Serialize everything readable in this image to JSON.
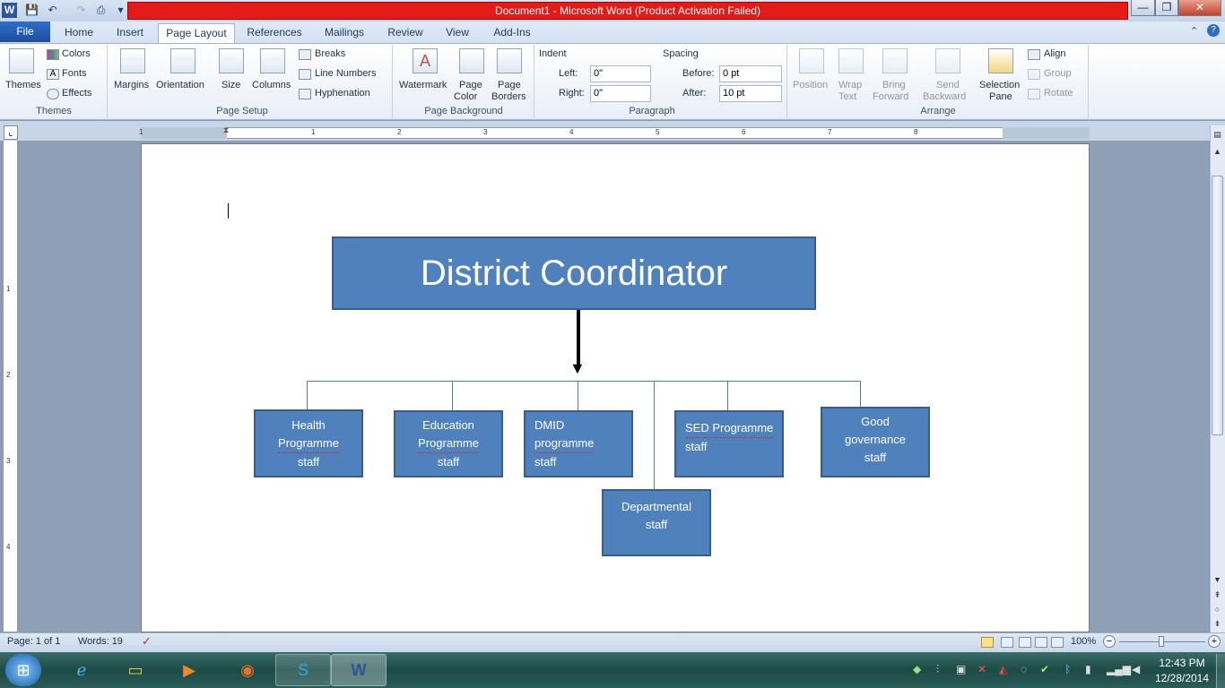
{
  "window": {
    "title": "Document1  -  Microsoft Word (Product Activation Failed)",
    "app_icon": "W"
  },
  "quick_access": {
    "save_icon": "💾",
    "undo_icon": "↶",
    "redo_icon": "↷",
    "print_icon": "⎙",
    "more_icon": "▾"
  },
  "window_controls": {
    "minimize": "—",
    "restore": "❐",
    "close": "✕"
  },
  "tabs": [
    {
      "label": "File"
    },
    {
      "label": "Home"
    },
    {
      "label": "Insert"
    },
    {
      "label": "Page Layout"
    },
    {
      "label": "References"
    },
    {
      "label": "Mailings"
    },
    {
      "label": "Review"
    },
    {
      "label": "View"
    },
    {
      "label": "Add-Ins"
    }
  ],
  "ribbon": {
    "themes": {
      "themes": "Themes",
      "colors": "Colors",
      "fonts": "Fonts",
      "effects": "Effects",
      "group": "Themes"
    },
    "page_setup": {
      "margins": "Margins",
      "orientation": "Orientation",
      "size": "Size",
      "columns": "Columns",
      "breaks": "Breaks",
      "line_numbers": "Line Numbers",
      "hyphenation": "Hyphenation",
      "group": "Page Setup"
    },
    "page_background": {
      "watermark": "Watermark",
      "page_color_1": "Page",
      "page_color_2": "Color",
      "page_borders_1": "Page",
      "page_borders_2": "Borders",
      "group": "Page Background"
    },
    "paragraph": {
      "indent": "Indent",
      "left": "Left:",
      "left_val": "0\"",
      "right": "Right:",
      "right_val": "0\"",
      "spacing": "Spacing",
      "before": "Before:",
      "before_val": "0 pt",
      "after": "After:",
      "after_val": "10 pt",
      "group": "Paragraph"
    },
    "arrange": {
      "position": "Position",
      "wrap_1": "Wrap",
      "wrap_2": "Text",
      "bring_1": "Bring",
      "bring_2": "Forward",
      "send_1": "Send",
      "send_2": "Backward",
      "sel_1": "Selection",
      "sel_2": "Pane",
      "align": "Align",
      "group_btn": "Group",
      "rotate": "Rotate",
      "group": "Arrange"
    }
  },
  "ruler": {
    "h_marks": [
      "1",
      "1",
      "2",
      "3",
      "4",
      "5",
      "6",
      "7",
      "8"
    ],
    "v_marks": [
      "1",
      "2",
      "3",
      "4"
    ]
  },
  "chart": {
    "top": "District Coordinator",
    "boxes": [
      {
        "lines": [
          "Health",
          "Programme",
          "staff"
        ]
      },
      {
        "lines": [
          "Education",
          "Programme",
          "staff"
        ]
      },
      {
        "lines": [
          "DMID",
          "programme",
          "staff"
        ]
      },
      {
        "lines": [
          "SED Programme",
          "staff"
        ]
      },
      {
        "lines": [
          "Good",
          "governance",
          "staff"
        ]
      },
      {
        "lines": [
          "Departmental",
          "staff"
        ]
      }
    ]
  },
  "status": {
    "page": "Page: 1 of 1",
    "words": "Words: 19",
    "zoom": "100%",
    "zoom_minus": "−",
    "zoom_plus": "+"
  },
  "taskbar": {
    "time": "12:43 PM",
    "date": "12/28/2014",
    "start_icon": "⊞"
  }
}
